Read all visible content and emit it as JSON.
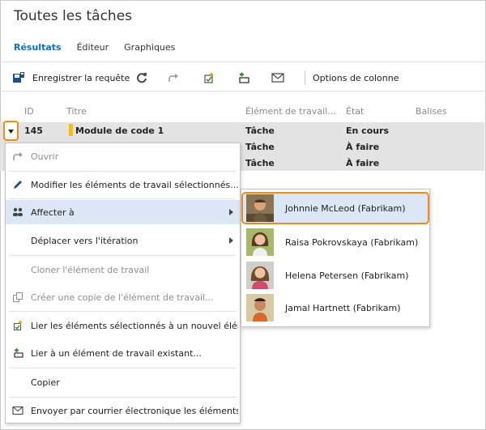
{
  "page": {
    "title": "Toutes les tâches"
  },
  "tabs": [
    {
      "label": "Résultats",
      "active": true
    },
    {
      "label": "Éditeur",
      "active": false
    },
    {
      "label": "Graphiques",
      "active": false
    }
  ],
  "toolbar": {
    "save_label": "Enregistrer la requête",
    "column_options_label": "Options de colonne",
    "icons": [
      "save-icon",
      "refresh-icon",
      "redo-icon",
      "new-work-item-link-icon",
      "link-existing-icon",
      "email-icon"
    ]
  },
  "table": {
    "headers": {
      "id": "ID",
      "title": "Titre",
      "type": "Élément de travail...",
      "state": "État",
      "tags": "Balises"
    },
    "rows": [
      {
        "id": "145",
        "title": "Module de code 1",
        "type": "Tâche",
        "state": "En cours"
      },
      {
        "id": "",
        "title": "",
        "type": "Tâche",
        "state": "À faire"
      },
      {
        "id": "",
        "title": "",
        "type": "Tâche",
        "state": "À faire"
      }
    ]
  },
  "context_menu": {
    "items": [
      {
        "label": "Ouvrir",
        "icon": "open-icon",
        "disabled": true
      },
      {
        "label": "Modifier les éléments de travail sélectionnés...",
        "icon": "pencil-icon",
        "disabled": false
      },
      {
        "label": "Affecter à",
        "icon": "assign-icon",
        "disabled": false,
        "submenu": true,
        "highlighted": true
      },
      {
        "label": "Déplacer vers l'itération",
        "icon": "",
        "disabled": false,
        "submenu": true
      },
      {
        "label": "Cloner l'élément de travail",
        "icon": "",
        "disabled": true
      },
      {
        "label": "Créer une copie de l'élément de travail...",
        "icon": "copy-icon",
        "disabled": true
      },
      {
        "label": "Lier les éléments sélectionnés à un nouvel élém...",
        "icon": "new-link-icon",
        "disabled": false
      },
      {
        "label": "Lier à un élément de travail existant...",
        "icon": "link-existing-icon",
        "disabled": false
      },
      {
        "label": "Copier",
        "icon": "",
        "disabled": false
      },
      {
        "label": "Envoyer par courrier électronique les éléments d...",
        "icon": "email-icon",
        "disabled": false
      }
    ]
  },
  "assign_submenu": {
    "people": [
      {
        "name": "Johnnie McLeod  (Fabrikam)",
        "selected": true
      },
      {
        "name": "Raisa Pokrovskaya (Fabrikam)",
        "selected": false
      },
      {
        "name": "Helena Petersen (Fabrikam)",
        "selected": false
      },
      {
        "name": "Jamal Hartnett (Fabrikam)",
        "selected": false
      }
    ]
  },
  "colors": {
    "accent": "#106ebe",
    "highlight_outline": "#f08a1d",
    "row_highlight": "#e3e3e3",
    "menu_highlight": "#dce7f5",
    "task_color": "#f2c200"
  }
}
